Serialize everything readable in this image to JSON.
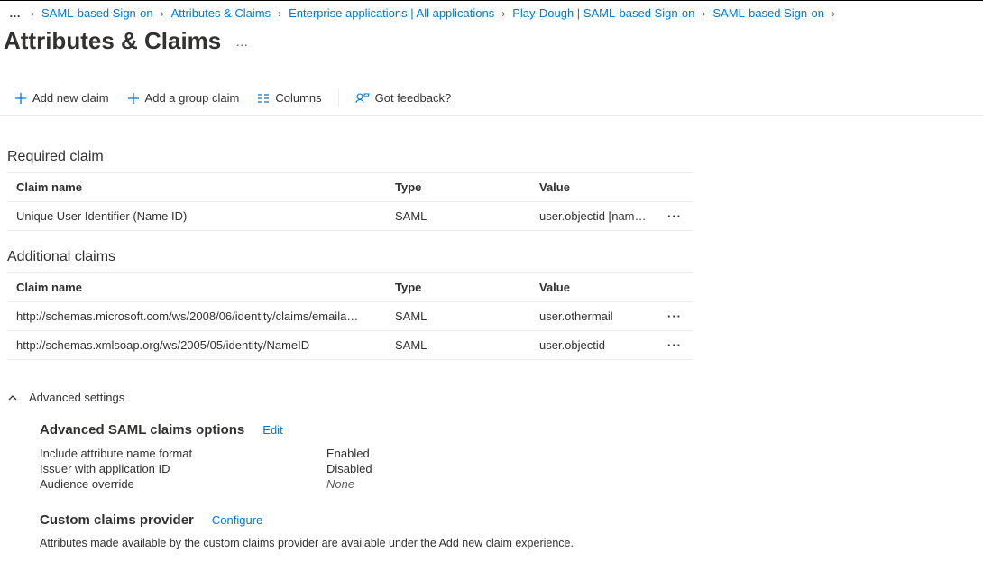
{
  "breadcrumb": {
    "items": [
      "SAML-based Sign-on",
      "Attributes & Claims",
      "Enterprise applications | All applications",
      "Play-Dough | SAML-based Sign-on",
      "SAML-based Sign-on"
    ]
  },
  "page": {
    "title": "Attributes & Claims"
  },
  "toolbar": {
    "add_new_claim": "Add new claim",
    "add_group_claim": "Add a group claim",
    "columns": "Columns",
    "feedback": "Got feedback?"
  },
  "required": {
    "title": "Required claim",
    "headers": {
      "name": "Claim name",
      "type": "Type",
      "value": "Value"
    },
    "rows": [
      {
        "name": "Unique User Identifier (Name ID)",
        "type": "SAML",
        "value": "user.objectid [nameid-fo…"
      }
    ]
  },
  "additional": {
    "title": "Additional claims",
    "headers": {
      "name": "Claim name",
      "type": "Type",
      "value": "Value"
    },
    "rows": [
      {
        "name": "http://schemas.microsoft.com/ws/2008/06/identity/claims/emaila…",
        "type": "SAML",
        "value": "user.othermail"
      },
      {
        "name": "http://schemas.xmlsoap.org/ws/2005/05/identity/NameID",
        "type": "SAML",
        "value": "user.objectid"
      }
    ]
  },
  "advanced": {
    "toggle": "Advanced settings",
    "saml_options": {
      "title": "Advanced SAML claims options",
      "edit": "Edit",
      "items": [
        {
          "key": "Include attribute name format",
          "value": "Enabled",
          "italic": false
        },
        {
          "key": "Issuer with application ID",
          "value": "Disabled",
          "italic": false
        },
        {
          "key": "Audience override",
          "value": "None",
          "italic": true
        }
      ]
    },
    "custom_provider": {
      "title": "Custom claims provider",
      "configure": "Configure",
      "description": "Attributes made available by the custom claims provider are available under the Add new claim experience."
    }
  }
}
